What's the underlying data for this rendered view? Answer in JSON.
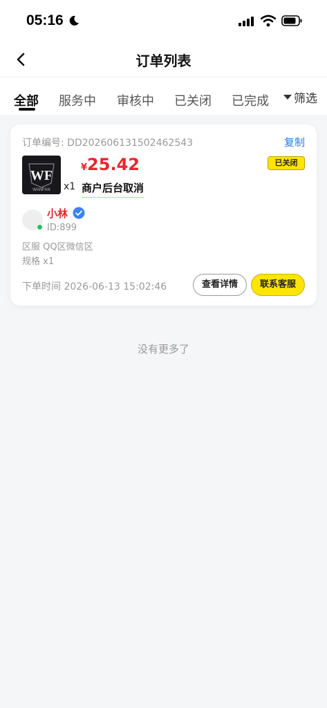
{
  "status_bar": {
    "time": "05:16"
  },
  "nav": {
    "title": "订单列表"
  },
  "tabs": [
    {
      "label": "全部",
      "active": true
    },
    {
      "label": "服务中",
      "active": false
    },
    {
      "label": "审核中",
      "active": false
    },
    {
      "label": "已关闭",
      "active": false
    },
    {
      "label": "已完成",
      "active": false
    }
  ],
  "filter_label": "筛选",
  "order": {
    "order_no": "订单编号: DD202606131502462543",
    "copy_label": "复制",
    "product_logo_text": "WF",
    "product_logo_sub": "WANFAN",
    "quantity": "x1",
    "currency": "¥",
    "price": "25.42",
    "cancel_reason": "商户后台取消",
    "status": "已关闭",
    "seller_name": "小林",
    "seller_id": "ID:899",
    "region": "区服 QQ区微信区",
    "spec": "规格 x1",
    "order_time": "下单时间 2026-06-13 15:02:46",
    "detail_button": "查看详情",
    "contact_button": "联系客服"
  },
  "footer": {
    "no_more": "没有更多了"
  },
  "colors": {
    "accent_yellow": "#ffe500",
    "price_red": "#e8262c",
    "link_blue": "#2d7be5",
    "online_green": "#25c15a"
  }
}
